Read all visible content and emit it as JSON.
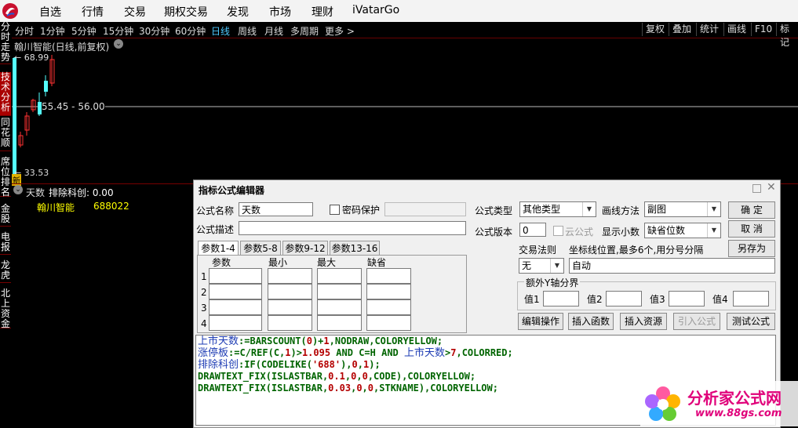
{
  "menubar": {
    "items": [
      "自选",
      "行情",
      "交易",
      "期权交易",
      "发现",
      "市场",
      "理财",
      "iVatarGo"
    ]
  },
  "toolbar": {
    "periods": [
      "分时",
      "1分钟",
      "5分钟",
      "15分钟",
      "30分钟",
      "60分钟",
      "日线",
      "周线",
      "月线",
      "多周期",
      "更多 >"
    ],
    "active_period": "日线",
    "right_buttons": [
      "复权",
      "叠加",
      "统计",
      "画线",
      "F10",
      "标记"
    ]
  },
  "sidebar": {
    "tabs": [
      "分时走势",
      "技术分析",
      "同花顺",
      "席位排名",
      "金股",
      "电报",
      "龙虎",
      "北上资金"
    ]
  },
  "chart": {
    "title": "翰川智能(日线,前复权)",
    "high_label": "68.99",
    "price_range": "55.45 - 56.00",
    "low_label": "33.53",
    "new_badge": "新",
    "colors": {
      "up": "#ff3232",
      "down": "#54ffff",
      "bg": "#000000"
    }
  },
  "sub_chart": {
    "title": "天数",
    "indicator": "排除科创: 0.00",
    "stock_name": "翰川智能",
    "stock_code": "688022"
  },
  "dialog": {
    "title": "指标公式编辑器",
    "name_label": "公式名称",
    "name_value": "天数",
    "password_label": "密码保护",
    "type_label": "公式类型",
    "type_value": "其他类型",
    "draw_label": "画线方法",
    "draw_value": "副图",
    "confirm": "确  定",
    "desc_label": "公式描述",
    "version_label": "公式版本",
    "version_value": "0",
    "cloud_label": "云公式",
    "decimal_label": "显示小数",
    "decimal_value": "缺省位数",
    "cancel": "取  消",
    "tabs": [
      "参数1-4",
      "参数5-8",
      "参数9-12",
      "参数13-16"
    ],
    "param_headers": [
      "参数",
      "最小",
      "最大",
      "缺省"
    ],
    "row_numbers": [
      "1",
      "2",
      "3",
      "4"
    ],
    "trade_rule_label": "交易法则",
    "trade_rule_value": "无",
    "axis_label": "坐标线位置,最多6个,用分号分隔",
    "axis_value": "自动",
    "save_as": "另存为",
    "y_axis_group": "额外Y轴分界",
    "value_labels": [
      "值1",
      "值2",
      "值3",
      "值4"
    ],
    "buttons": [
      "编辑操作",
      "插入函数",
      "插入资源",
      "引入公式",
      "测试公式"
    ]
  },
  "code": {
    "lines": [
      {
        "parts": [
          [
            "cn",
            "上市天数"
          ],
          [
            "",
            ":=BARSCOUNT("
          ],
          [
            "num",
            "0"
          ],
          [
            "",
            ")+"
          ],
          [
            "num",
            "1"
          ],
          [
            "",
            ",NODRAW,COLORYELLOW;"
          ]
        ]
      },
      {
        "parts": [
          [
            "cn",
            "涨停板"
          ],
          [
            "",
            ":=C/REF(C,"
          ],
          [
            "num",
            "1"
          ],
          [
            "",
            ")>"
          ],
          [
            "num",
            "1.095"
          ],
          [
            "",
            " AND C=H AND "
          ],
          [
            "cn",
            "上市天数"
          ],
          [
            "",
            ">"
          ],
          [
            "num",
            "7"
          ],
          [
            "",
            ",COLORRED;"
          ]
        ]
      },
      {
        "parts": [
          [
            "cn",
            "排除科创"
          ],
          [
            "",
            ":IF(CODELIKE("
          ],
          [
            "str",
            "'688'"
          ],
          [
            "",
            ")"
          ],
          [
            "",
            ","
          ],
          [
            "num",
            "0"
          ],
          [
            "",
            ","
          ],
          [
            "num",
            "1"
          ],
          [
            "",
            ");"
          ]
        ]
      },
      {
        "parts": [
          [
            "",
            "DRAWTEXT_FIX(ISLASTBAR,"
          ],
          [
            "num",
            "0.1"
          ],
          [
            "",
            ","
          ],
          [
            "num",
            "0"
          ],
          [
            "",
            ","
          ],
          [
            "num",
            "0"
          ],
          [
            "",
            ",CODE),COLORYELLOW;"
          ]
        ]
      },
      {
        "parts": [
          [
            "",
            "DRAWTEXT_FIX(ISLASTBAR,"
          ],
          [
            "num",
            "0.03"
          ],
          [
            "",
            ","
          ],
          [
            "num",
            "0"
          ],
          [
            "",
            ","
          ],
          [
            "num",
            "0"
          ],
          [
            "",
            ",STKNAME),COLORYELLOW;"
          ]
        ]
      }
    ]
  },
  "watermark": {
    "title": "分析家公式网",
    "url": "www.88gs.com"
  }
}
